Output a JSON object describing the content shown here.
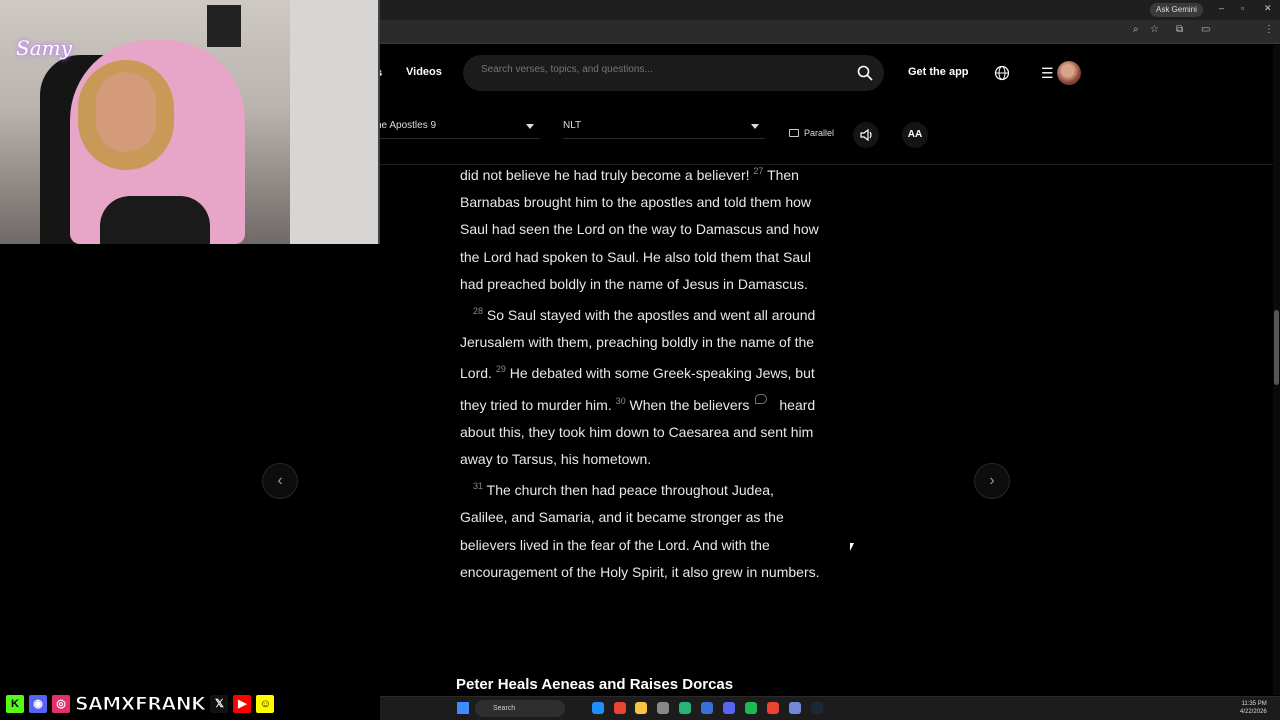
{
  "browser": {
    "gemini_label": "Ask Gemini",
    "window_controls": [
      "–",
      "▫",
      "✕"
    ]
  },
  "header": {
    "nav_fragment": "s",
    "videos": "Videos",
    "search_placeholder": "Search verses, topics, and questions...",
    "get_app": "Get the app",
    "menu_glyph": "☰"
  },
  "toolbar": {
    "book_label": "he Apostles 9",
    "version_label": "NLT",
    "parallel_label": "Parallel",
    "font_label": "AA"
  },
  "reader": {
    "p1_pre": "did not believe he had truly become a believer!",
    "v27": "27",
    "p1_post": "Then Barnabas brought him to the apostles and told them how Saul had seen the Lord on the way to Damascus and how the Lord had spoken to Saul. He also told them that Saul had preached boldly in the name of Jesus in Damascus.",
    "v28": "28",
    "p2_a": "So Saul stayed with the apostles and went all around Jerusalem with them, preaching boldly in the name of the Lord.",
    "v29": "29",
    "p2_b": "He debated with some Greek-speaking Jews, but they tried to murder him.",
    "v30": "30",
    "p2_c": "When the believers",
    "p2_d": "heard about this, they took him down to Caesarea and sent him away to Tarsus, his hometown.",
    "v31": "31",
    "p3": "The church then had peace throughout Judea, Galilee, and Samaria, and it became stronger as the believers lived in the fear of the Lord. And with the encouragement of the Holy Spirit, it also grew in numbers.",
    "section_heading": "Peter Heals Aeneas and Raises Dorcas"
  },
  "navigation": {
    "prev_glyph": "‹",
    "next_glyph": "›"
  },
  "overlay": {
    "logo": "Samy",
    "handle": "SAMXFRANK",
    "icons": [
      "kick-icon",
      "discord-icon",
      "instagram-icon",
      "x-icon",
      "youtube-icon",
      "snapchat-icon"
    ],
    "x_glyph": "𝕏"
  },
  "taskbar": {
    "search_label": "Search",
    "time": "11:35 PM",
    "date": "4/22/2026"
  },
  "colors": {
    "background": "#000000",
    "text": "#e8e8e8",
    "verse_number": "#888888",
    "kick": "#53fc18",
    "discord": "#5865f2",
    "instagram": "#e1306c",
    "youtube": "#ff0000",
    "snapchat": "#fffc00"
  }
}
